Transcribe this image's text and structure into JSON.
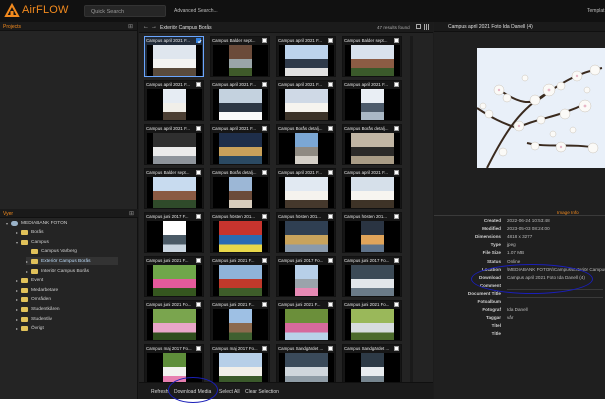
{
  "app": {
    "brand": "AirFLOW"
  },
  "topbar": {
    "search_placeholder": "Quick Search",
    "advanced_label": "Advanced Search...",
    "templates_label": "Templat"
  },
  "projects": {
    "title": "Projects"
  },
  "views": {
    "title": "Vyer"
  },
  "tree": [
    {
      "label": "MEDIABANK FOTON",
      "type": "db",
      "arrow": "▾"
    },
    {
      "label": "Borås",
      "type": "folder",
      "arrow": "▸"
    },
    {
      "label": "Campus",
      "type": "folder",
      "arrow": "▾"
    },
    {
      "label": "Campus Varberg",
      "type": "folder",
      "arrow": ""
    },
    {
      "label": "Exteriör Campus Borås",
      "type": "folder",
      "arrow": "▸",
      "selected": true
    },
    {
      "label": "Interiör Campus Borås",
      "type": "folder",
      "arrow": "▸"
    },
    {
      "label": "Event",
      "type": "folder",
      "arrow": "▸"
    },
    {
      "label": "Medarbetare",
      "type": "folder",
      "arrow": "▸"
    },
    {
      "label": "Områden",
      "type": "folder",
      "arrow": "▸"
    },
    {
      "label": "Studentkåren",
      "type": "folder",
      "arrow": "▸"
    },
    {
      "label": "Studentliv",
      "type": "folder",
      "arrow": "▸"
    },
    {
      "label": "Övrigt",
      "type": "folder",
      "arrow": "▸"
    }
  ],
  "center": {
    "breadcrumb": "Exteriör Campus Borås",
    "results": "47 results found"
  },
  "grid": [
    {
      "label": "Campus april 2021 F...",
      "checked": true
    },
    {
      "label": "Campus Balder sept...",
      "checked": false
    },
    {
      "label": "Campus april 2021 F...",
      "checked": false
    },
    {
      "label": "Campus Balder sept...",
      "checked": false
    },
    {
      "label": "Campus april 2021 F...",
      "checked": false
    },
    {
      "label": "Campus april 2021 F...",
      "checked": false
    },
    {
      "label": "Campus april 2021 F...",
      "checked": false
    },
    {
      "label": "Campus april 2021 F...",
      "checked": false
    },
    {
      "label": "Campus april 2021 F...",
      "checked": false
    },
    {
      "label": "Campus april 2021 F...",
      "checked": false
    },
    {
      "label": "Campus Borås detalj...",
      "checked": false
    },
    {
      "label": "Campus Borås detalj...",
      "checked": false
    },
    {
      "label": "Campus Balder sept...",
      "checked": false
    },
    {
      "label": "Campus Borås detalj...",
      "checked": false
    },
    {
      "label": "Campus april 2021 F...",
      "checked": false
    },
    {
      "label": "Campus april 2021 F...",
      "checked": false
    },
    {
      "label": "Campus juni 2017 F...",
      "checked": false
    },
    {
      "label": "Campus hösten 201...",
      "checked": false
    },
    {
      "label": "Campus hösten 201...",
      "checked": false
    },
    {
      "label": "Campus hösten 201...",
      "checked": false
    },
    {
      "label": "Campus juni 2021 F...",
      "checked": false
    },
    {
      "label": "Campus juni 2021 F...",
      "checked": false
    },
    {
      "label": "Campus juni 2017 Fo...",
      "checked": false
    },
    {
      "label": "Campus juni 2017 Fo...",
      "checked": false
    },
    {
      "label": "Campus juni 2021 Fo...",
      "checked": false
    },
    {
      "label": "Campus juni 2021 F...",
      "checked": false
    },
    {
      "label": "Campus juni 2021 F...",
      "checked": false
    },
    {
      "label": "Campus juni 2021 Fo...",
      "checked": false
    },
    {
      "label": "Campus maj 2017 Fo...",
      "checked": false
    },
    {
      "label": "Campus maj 2017 Fo...",
      "checked": false
    },
    {
      "label": "Campus Sandgärdet ...",
      "checked": false
    },
    {
      "label": "Campus Sandgärdet ...",
      "checked": false
    }
  ],
  "bottom_actions": {
    "refresh": "Refresh",
    "download": "Download Media",
    "select_all": "Select All",
    "clear": "Clear Selection"
  },
  "right": {
    "title": "Campus april 2021 Foto Ida Danell (4)",
    "image_info_label": "Image Info",
    "metadata": [
      {
        "key": "Created",
        "value": "2022-06-24 10:53:48"
      },
      {
        "key": "Modified",
        "value": "2023-05-03 08:24:00"
      },
      {
        "key": "Dimensions",
        "value": "4818 x 3277"
      },
      {
        "key": "Type",
        "value": "jpeg"
      },
      {
        "key": "File Size",
        "value": "1.07 MB"
      },
      {
        "key": "Status",
        "value": "Online"
      },
      {
        "key": "Location",
        "value": "\\MEDIABANK FOTON\\Campus\\Exteriör Campus"
      },
      {
        "key": "Download",
        "value": "Campus april 2021 Foto Ida Danell (4)"
      },
      {
        "key": "Comment",
        "value": ""
      },
      {
        "key": "Document Title",
        "value": ""
      },
      {
        "key": "Fotoalbum",
        "value": ""
      },
      {
        "key": "Fotograf",
        "value": "Ida Danell"
      },
      {
        "key": "Taggar",
        "value": "vår"
      },
      {
        "key": "Titel",
        "value": ""
      },
      {
        "key": "Title",
        "value": ""
      }
    ]
  },
  "icons": {
    "back": "arrow-left-icon",
    "forward": "arrow-right-icon",
    "list": "list-view-icon",
    "grid": "grid-view-icon",
    "pin": "pin-icon"
  },
  "colors": {
    "accent": "#f28a1e",
    "panel": "#1c1c1c",
    "annotation": "#1a1fb8"
  }
}
